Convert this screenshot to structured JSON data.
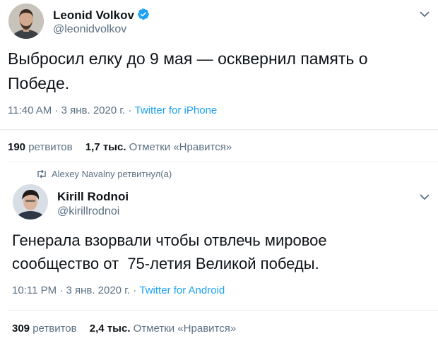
{
  "colors": {
    "accent": "#1da1f2",
    "secondary_text": "#5b7083",
    "primary_text": "#0f1419",
    "divider": "#e6ecf0"
  },
  "tweet1": {
    "author_name": "Leonid Volkov",
    "verified_icon": "verified-badge-icon",
    "handle": "@leonidvolkov",
    "text": "Выбросил елку до 9 мая — осквернил память о Победе.",
    "time": "11:40 AM",
    "date": "3 янв. 2020 г.",
    "separator": "·",
    "source": "Twitter for iPhone",
    "retweets_count": "190",
    "retweets_label": "ретвитов",
    "likes_count": "1,7 тыс.",
    "likes_label": "Отметки «Нравится»"
  },
  "retweet_context": {
    "icon": "retweet-icon",
    "text": "Alexey Navalny ретвитнул(а)"
  },
  "tweet2": {
    "author_name": "Kirill Rodnoi",
    "handle": "@kirillrodnoi",
    "text": "Генерала взорвали чтобы отвлечь мировое сообщество от  75-летия Великой победы.",
    "time": "10:11 PM",
    "date": "3 янв. 2020 г.",
    "separator": "·",
    "source": "Twitter for Android",
    "retweets_count": "309",
    "retweets_label": "ретвитов",
    "likes_count": "2,4 тыс.",
    "likes_label": "Отметки «Нравится»"
  }
}
